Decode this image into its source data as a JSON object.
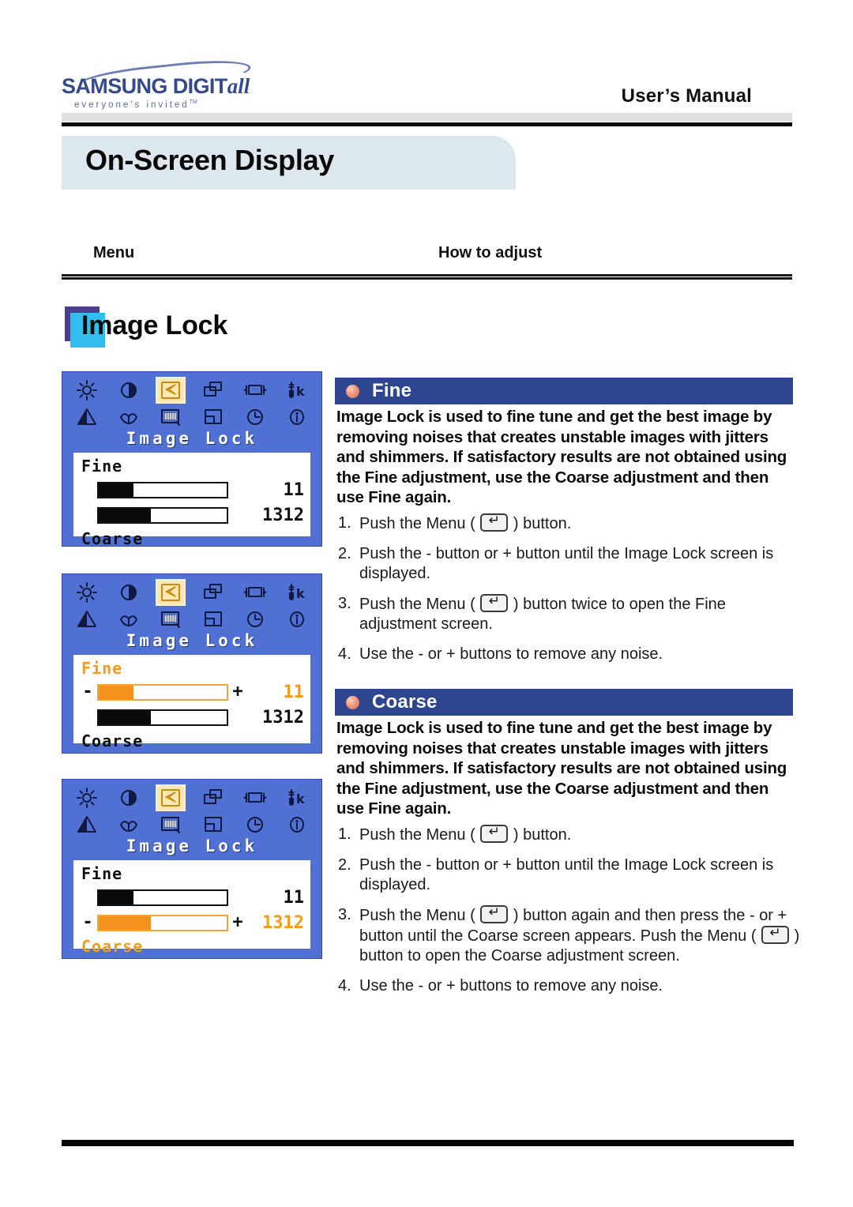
{
  "header": {
    "brand_wordmark": "SAMSUNG DIGIT",
    "brand_wordmark_tail": "all",
    "brand_tagline": "everyone's invited",
    "brand_tagline_tm": "TM",
    "manual_label": "User’s Manual"
  },
  "page": {
    "title": "On-Screen Display",
    "column_menu": "Menu",
    "column_howto": "How to adjust",
    "section_label": "Image Lock"
  },
  "colors": {
    "osd_background": "#5071d3",
    "osd_highlight": "#f5921e",
    "section_header_blue": "#2e4590",
    "title_bar_blue": "#dde7ee",
    "accent_cyan": "#33bdee",
    "accent_purple": "#4a3f8c",
    "bullet_salmon": "#f09377"
  },
  "osd_icons": {
    "row1": [
      "brightness-icon",
      "contrast-icon",
      "image-lock-icon",
      "position-icon",
      "h-size-icon",
      "color-temp-kelvin-icon"
    ],
    "row2": [
      "gamma-icon",
      "color-control-icon",
      "moire-icon",
      "osd-position-icon",
      "reset-clock-icon",
      "information-icon"
    ],
    "selected": "image-lock-icon"
  },
  "osd_screens": [
    {
      "name": "osd-image-lock-overview",
      "title": "Image Lock",
      "fine_label": "Fine",
      "fine_value": "11",
      "fine_percent": 27,
      "fine_active": false,
      "coarse_label": "Coarse",
      "coarse_value": "1312",
      "coarse_percent": 41,
      "coarse_active": false,
      "minus_label": "-",
      "plus_label": "+",
      "show_fine_controls": false,
      "show_coarse_controls": false
    },
    {
      "name": "osd-fine-adjust",
      "title": "Image Lock",
      "fine_label": "Fine",
      "fine_value": "11",
      "fine_percent": 27,
      "fine_active": true,
      "coarse_label": "Coarse",
      "coarse_value": "1312",
      "coarse_percent": 41,
      "coarse_active": false,
      "minus_label": "-",
      "plus_label": "+",
      "show_fine_controls": true,
      "show_coarse_controls": false
    },
    {
      "name": "osd-coarse-adjust",
      "title": "Image Lock",
      "fine_label": "Fine",
      "fine_value": "11",
      "fine_percent": 27,
      "fine_active": false,
      "coarse_label": "Coarse",
      "coarse_value": "1312",
      "coarse_percent": 41,
      "coarse_active": true,
      "minus_label": "-",
      "plus_label": "+",
      "show_fine_controls": false,
      "show_coarse_controls": true
    }
  ],
  "sections": [
    {
      "heading": "Fine",
      "body": "Image Lock is used to fine tune and get the best image by removing noises that creates unstable images with jitters and shimmers. If satisfactory results are not obtained using the Fine adjustment, use the Coarse adjustment and then use Fine again.",
      "steps": [
        {
          "num": "1.",
          "parts": [
            "Push the Menu ( ",
            " ) button."
          ]
        },
        {
          "num": "2.",
          "parts": [
            "Push the - button or + button until the Image Lock screen is displayed."
          ]
        },
        {
          "num": "3.",
          "parts": [
            "Push the Menu ( ",
            " ) button twice to open the Fine adjustment screen."
          ]
        },
        {
          "num": "4.",
          "parts": [
            "Use the - or + buttons to remove any noise."
          ]
        }
      ]
    },
    {
      "heading": "Coarse",
      "body": "Image Lock is used to fine tune and get the best image by removing noises that creates unstable images with jitters and shimmers. If satisfactory results are not obtained using the Fine adjustment, use the Coarse adjustment and then use Fine again.",
      "steps": [
        {
          "num": "1.",
          "parts": [
            "Push the Menu ( ",
            " ) button."
          ]
        },
        {
          "num": "2.",
          "parts": [
            "Push the - button or + button until the Image Lock screen is displayed."
          ]
        },
        {
          "num": "3.",
          "parts": [
            "Push the Menu ( ",
            " ) button again and then  press the - or + button until the Coarse screen appears. Push the Menu ( ",
            " ) button to open the Coarse adjustment screen."
          ]
        },
        {
          "num": "4.",
          "parts": [
            "Use the - or + buttons to remove any noise."
          ]
        }
      ]
    }
  ]
}
